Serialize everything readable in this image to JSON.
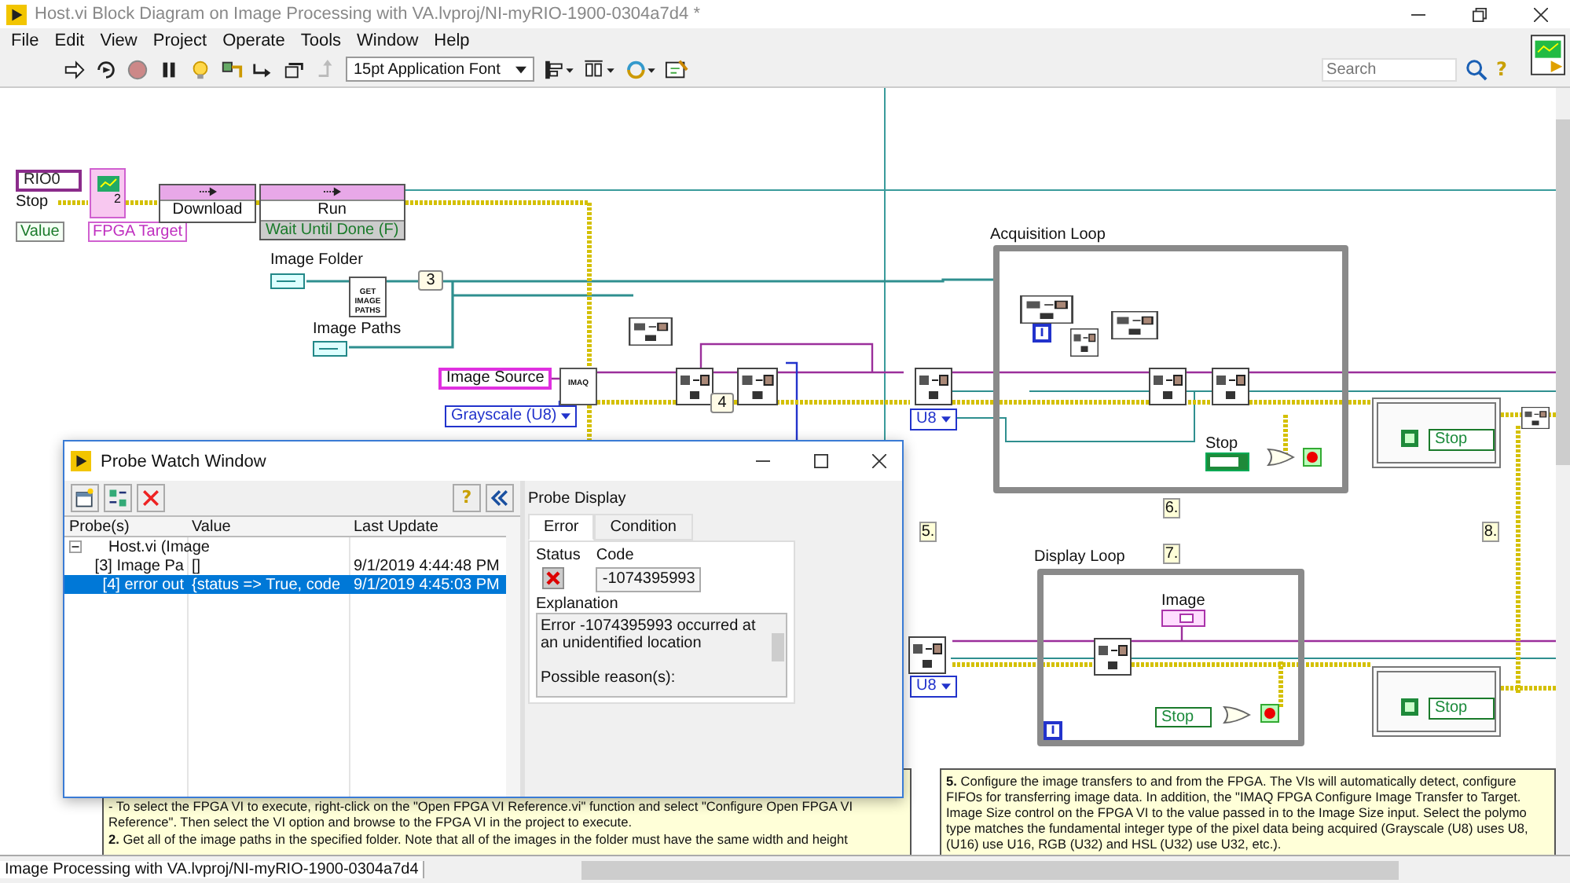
{
  "window": {
    "title": "Host.vi Block Diagram on Image Processing with VA.lvproj/NI-myRIO-1900-0304a7d4 *"
  },
  "menu": [
    "File",
    "Edit",
    "View",
    "Project",
    "Operate",
    "Tools",
    "Window",
    "Help"
  ],
  "toolbar": {
    "font": "15pt Application Font",
    "search_placeholder": "Search",
    "help": "?"
  },
  "diagram": {
    "items": [
      {
        "kind": "ref_constant",
        "text": "RIO0"
      },
      {
        "kind": "label",
        "text": "Stop"
      },
      {
        "kind": "bool_property",
        "text": "Value"
      },
      {
        "kind": "vi_icon",
        "text": "2"
      },
      {
        "kind": "ref_label",
        "text": "FPGA Target"
      },
      {
        "kind": "method",
        "text": "Download"
      },
      {
        "kind": "method",
        "text": "Run",
        "sub": "Wait Until Done (F)"
      },
      {
        "kind": "label",
        "text": "Image Folder"
      },
      {
        "kind": "subvi",
        "text": "GET IMAGE PATHS"
      },
      {
        "kind": "numeric_constant",
        "text": "3"
      },
      {
        "kind": "label",
        "text": "Image Paths"
      },
      {
        "kind": "imaq_control",
        "text": "Image Source"
      },
      {
        "kind": "subvi",
        "text": "IMAQ"
      },
      {
        "kind": "enum",
        "text": "Grayscale (U8)"
      },
      {
        "kind": "numeric_constant",
        "text": "4"
      },
      {
        "kind": "enum",
        "text": "U8"
      },
      {
        "kind": "label",
        "text": "Acquisition Loop"
      },
      {
        "kind": "iteration",
        "text": "i"
      },
      {
        "kind": "label",
        "text": "Stop"
      },
      {
        "kind": "note",
        "text": "5."
      },
      {
        "kind": "note",
        "text": "6."
      },
      {
        "kind": "note",
        "text": "8."
      },
      {
        "kind": "note",
        "text": "7."
      },
      {
        "kind": "label",
        "text": "Display Loop"
      },
      {
        "kind": "label",
        "text": "Image"
      },
      {
        "kind": "local_variable",
        "text": "Stop"
      },
      {
        "kind": "iteration",
        "text": "i"
      },
      {
        "kind": "local_variable",
        "text": "Stop"
      },
      {
        "kind": "local_variable",
        "text": "Stop"
      },
      {
        "kind": "enum",
        "text": "U8"
      }
    ],
    "comments": [
      {
        "lines": [
          " - To select the FPGA VI to execute, right-click on the \"Open FPGA VI Reference.vi\" function and select \"Configure Open FPGA VI",
          "Reference\".  Then select the VI option and browse to the FPGA VI in the project to execute.",
          "**2.** Get all of the image paths in the specified folder.  Note that all of the images in the folder must have the same width and height"
        ]
      },
      {
        "lines": [
          "**5.** Configure the image transfers to and from the FPGA.  The VIs will automatically detect, configure",
          "FIFOs for transferring image data.  In addition, the \"IMAQ FPGA Configure Image Transfer to Target.",
          "Image Size control on the FPGA VI to the value passed in to the Image Size input.  Select the polymo",
          "type matches the fundamental integer type of the pixel data being acquired (Grayscale (U8) uses U8,",
          "(U16) use U16, RGB (U32) and HSL (U32) use U32, etc.)."
        ]
      }
    ]
  },
  "probe_window": {
    "title": "Probe Watch Window",
    "help": "?",
    "columns": [
      "Probe(s)",
      "Value",
      "Last Update"
    ],
    "rows": [
      {
        "probe": "Host.vi (Image",
        "expanded": true,
        "selected": false,
        "children": [
          {
            "probe": "[3] Image Pa",
            "value": "[]",
            "last_update": "9/1/2019 4:44:48 PM",
            "selected": false
          },
          {
            "probe": "[4] error out",
            "value": "{status => True, code",
            "last_update": "9/1/2019 4:45:03 PM",
            "selected": true
          }
        ]
      }
    ],
    "display": {
      "title": "Probe Display",
      "tabs": [
        {
          "label": "Error",
          "selected": true
        },
        {
          "label": "Condition",
          "selected": false
        }
      ],
      "status_label": "Status",
      "status_error": true,
      "code_label": "Code",
      "code": "-1074395993",
      "explanation_label": "Explanation",
      "explanation": "Error -1074395993 occurred at an unidentified location\n\nPossible reason(s):"
    }
  },
  "status_bar": {
    "path": "Image Processing with VA.lvproj/NI-myRIO-1900-0304a7d4"
  }
}
